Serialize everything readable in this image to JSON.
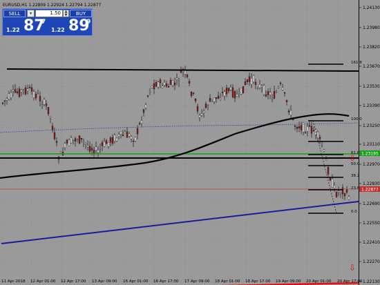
{
  "symbol_info": "EURUSD,H1  1.22809 1.22924 1.22794 1.22877",
  "trade_panel": {
    "sell_label": "SELL",
    "buy_label": "BUY",
    "lot_value": "1.50",
    "sell_small": "1.22",
    "sell_big": "87",
    "sell_sup": "7",
    "buy_small": "1.22",
    "buy_big": "89",
    "buy_sup": "9"
  },
  "price_axis": [
    "1.24130",
    "1.23980",
    "1.23820",
    "1.23670",
    "1.23530",
    "1.23390",
    "1.23250",
    "1.23110",
    "1.22970",
    "1.22830",
    "1.22690",
    "1.22550",
    "1.22410",
    "1.22270",
    "1.22130"
  ],
  "price_tags": [
    {
      "label": "1.23195",
      "color": "#19a019"
    },
    {
      "label": "1.22877",
      "color": "#c03030"
    }
  ],
  "time_axis": [
    "11 Apr 2018",
    "12 Apr 01:00",
    "12 Apr 17:00",
    "13 Apr 09:00",
    "16 Apr 01:00",
    "16 Apr 17:00",
    "17 Apr 09:00",
    "18 Apr 01:00",
    "18 Apr 17:00",
    "19 Apr 09:00",
    "20 Apr 01:00",
    "20 Apr 17:00"
  ],
  "fib_labels": [
    "161.8",
    "100.0",
    "61.8",
    "50.0",
    "38.2",
    "23.6",
    "0.0"
  ],
  "colors": {
    "background": "#9a9a9a",
    "axis_bg": "#9a9a9a",
    "candle_bull": "#e0e0e0",
    "candle_bear": "#8b1a1a",
    "ma_black": "#000000",
    "trend_blue": "#1a1aa0",
    "trend_red": "#e01010",
    "support_green": "#19a019",
    "dotted_blue": "#3a3ab0"
  }
}
